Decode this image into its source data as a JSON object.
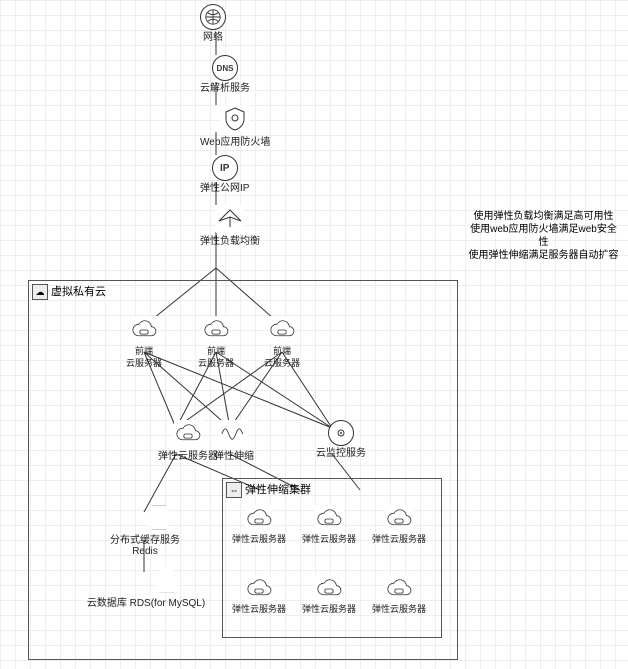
{
  "top_chain": {
    "network": "网络",
    "dns": "云解析服务",
    "waf": "Web应用防火墙",
    "eip": "弹性公网IP",
    "elb": "弹性负载均衡"
  },
  "vpc": {
    "title": "虚拟私有云",
    "frontends": [
      {
        "line1": "前端",
        "line2": "云服务器"
      },
      {
        "line1": "前端",
        "line2": "云服务器"
      },
      {
        "line1": "前端",
        "line2": "云服务器"
      }
    ],
    "ecs": "弹性云服务器",
    "as": "弹性伸缩",
    "ces": "云监控服务",
    "redis": "分布式缓存服务Redis",
    "rds": "云数据库 RDS(for MySQL)"
  },
  "as_group": {
    "title": "弹性伸缩集群",
    "servers": [
      "弹性云服务器",
      "弹性云服务器",
      "弹性云服务器",
      "弹性云服务器",
      "弹性云服务器",
      "弹性云服务器"
    ]
  },
  "notes": [
    "使用弹性负载均衡满足高可用性",
    "使用web应用防火墙满足web安全性",
    "使用弹性伸缩满足服务器自动扩容"
  ],
  "icons": {
    "globe": "globe-icon",
    "dns": "DNS",
    "shield": "shield-icon",
    "ip": "IP",
    "lb": "load-balancer-icon",
    "cloud": "cloud-icon",
    "spring": "auto-scaling-icon",
    "eye": "monitoring-icon",
    "hex": "redis-icon",
    "dolphin": "mysql-icon",
    "vpc": "vpc-icon",
    "as_group": "as-group-icon"
  }
}
